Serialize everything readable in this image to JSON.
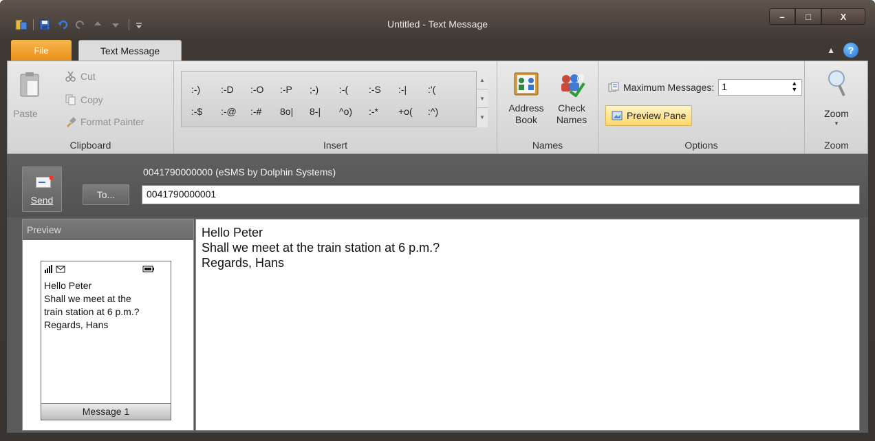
{
  "window": {
    "title": "Untitled  -  Text Message",
    "controls": {
      "minimize": "–",
      "maximize": "□",
      "close": "X"
    }
  },
  "tabs": [
    {
      "label": "File"
    },
    {
      "label": "Text Message"
    }
  ],
  "ribbon": {
    "clipboard": {
      "paste": "Paste",
      "cut": "Cut",
      "copy": "Copy",
      "format_painter": "Format Painter",
      "label": "Clipboard"
    },
    "insert": {
      "row1": [
        ":-)",
        ":-D",
        ":-O",
        ":-P",
        ";-)",
        ":-(",
        ":-S",
        ":-|",
        ":'("
      ],
      "row2": [
        ":-$",
        ":-@",
        ":-#",
        "8o|",
        "8-|",
        "^o)",
        ":-*",
        "+o(",
        ":^)"
      ],
      "label": "Insert"
    },
    "names": {
      "address_book_line1": "Address",
      "address_book_line2": "Book",
      "check_names_line1": "Check",
      "check_names_line2": "Names",
      "label": "Names"
    },
    "options": {
      "max_messages_label": "Maximum Messages:",
      "max_messages_value": "1",
      "preview_pane": "Preview Pane",
      "label": "Options"
    },
    "zoom": {
      "button": "Zoom",
      "label": "Zoom"
    }
  },
  "compose": {
    "send_label": "Send",
    "to_label": "To...",
    "from": "0041790000000 (eSMS by Dolphin Systems)",
    "to_value": "0041790000001"
  },
  "preview": {
    "header": "Preview",
    "phone_text": "Hello Peter\nShall we meet at the\ntrain station at 6 p.m.?\nRegards, Hans",
    "footer": "Message 1"
  },
  "message": {
    "body": "Hello Peter\nShall we meet at the train station at 6 p.m.?\nRegards, Hans"
  },
  "colors": {
    "file_tab": "#e9901b",
    "preview_highlight": "#ffd86a"
  }
}
